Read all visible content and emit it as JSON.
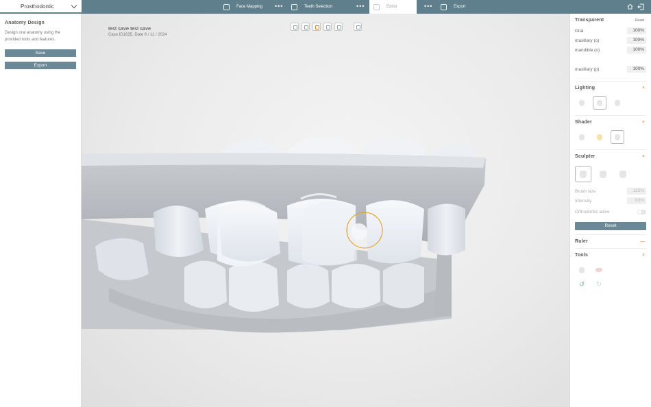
{
  "topbar": {
    "mode": "Prosthodontic",
    "steps": [
      {
        "label": "Face Mapping",
        "icon": "face-scan-icon"
      },
      {
        "label": "Teeth Selection",
        "icon": "teeth-grid-icon"
      },
      {
        "label": "Editor",
        "icon": "tooth-edit-icon"
      },
      {
        "label": "Export",
        "icon": "export-doc-icon"
      }
    ],
    "dots": "•••",
    "active_step": "Editor"
  },
  "left": {
    "title": "Anatomy Design",
    "description": "Design oral anatomy using the provided tools and features.",
    "save": "Save",
    "export": "Export"
  },
  "viewport": {
    "case_title": "test save test save",
    "case_info": "Case ID1635, Date 6 / 11 / 2024"
  },
  "right": {
    "transparent": {
      "title": "Transparent",
      "reset": "Reset",
      "rows": [
        {
          "label": "Oral",
          "value": "100%"
        },
        {
          "label": "maxillary (o)",
          "value": "100%"
        },
        {
          "label": "mandible (o)",
          "value": "100%"
        },
        {
          "label": "maxillary (p)",
          "value": "100%"
        }
      ]
    },
    "lighting": {
      "title": "Lighting",
      "close": "×"
    },
    "shader": {
      "title": "Shader",
      "close": "×"
    },
    "sculpter": {
      "title": "Sculpter",
      "close": "×",
      "brush_label": "Brush size",
      "brush_value": "122%",
      "intensity_label": "Intensity",
      "intensity_value": "63%",
      "ortho_label": "Orthodontic allow",
      "reset": "Reset"
    },
    "ruler": {
      "title": "Ruler",
      "action": "—"
    },
    "tools": {
      "title": "Tools",
      "close": "×",
      "undo": "↺",
      "redo": "↻"
    }
  },
  "colors": {
    "topbar": "#5f7f8d",
    "button": "#6a8896",
    "accent": "#e07a2b",
    "brush_ring": "#e3a62e"
  }
}
